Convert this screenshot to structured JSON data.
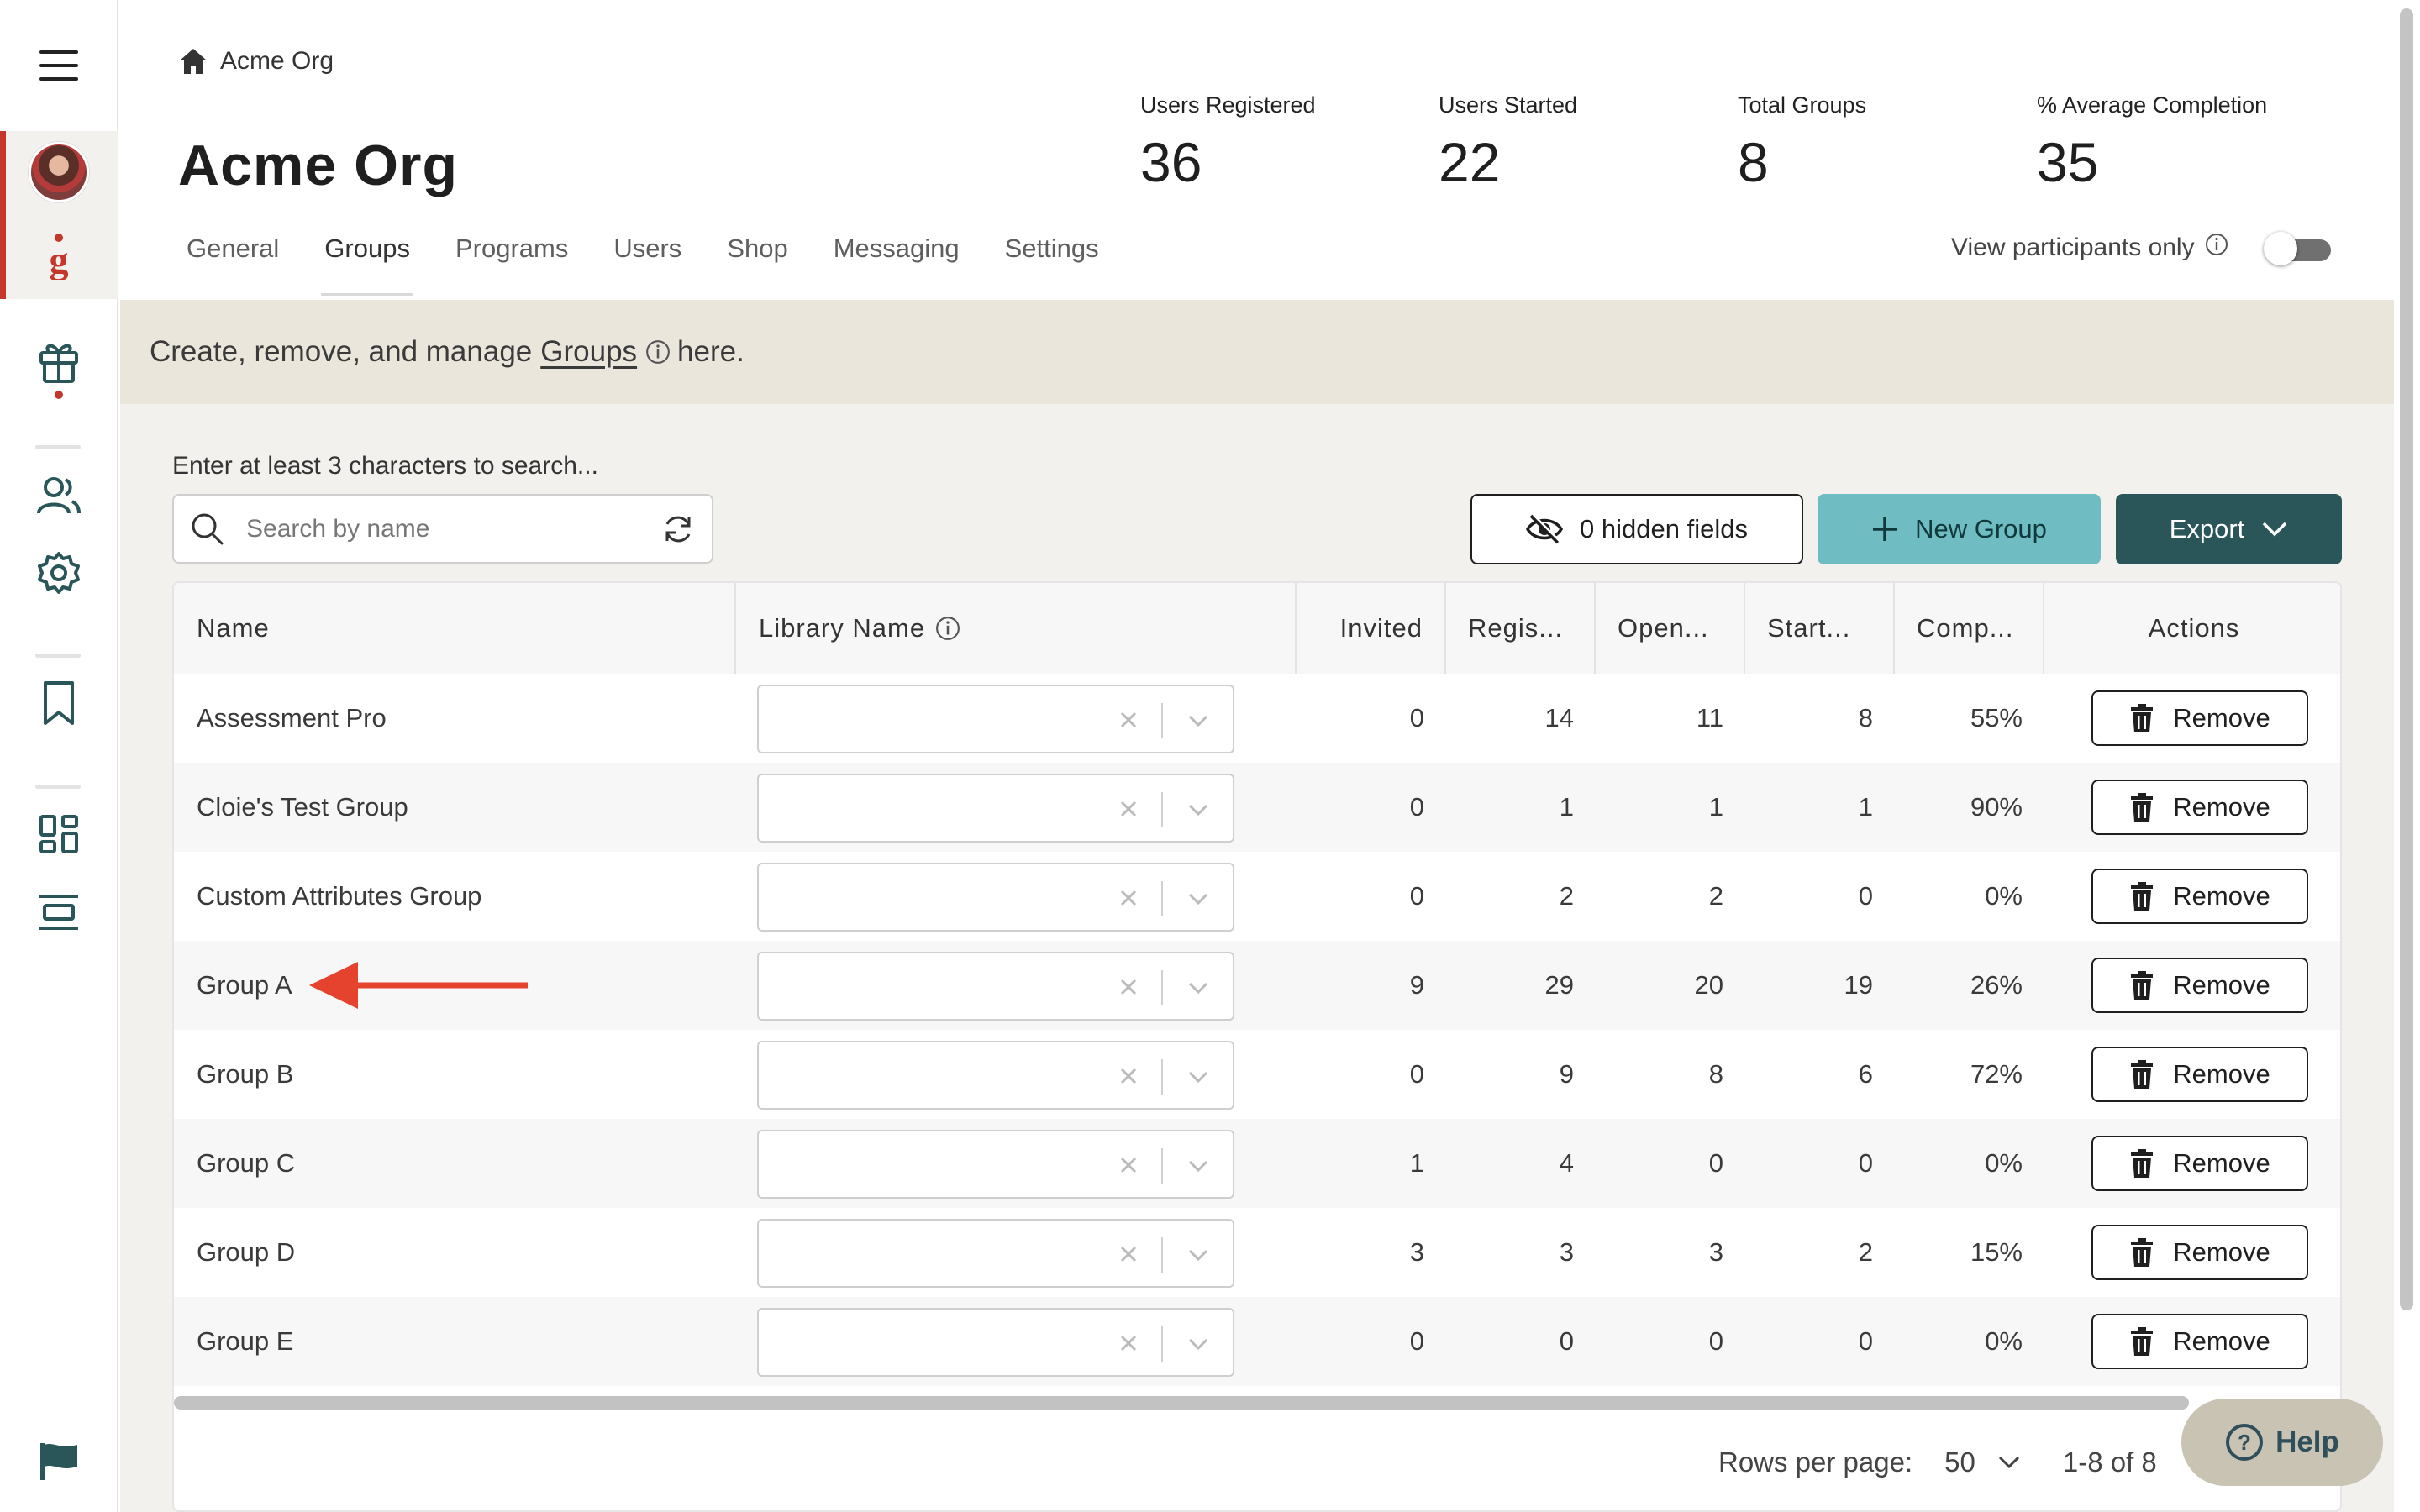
{
  "breadcrumb": {
    "label": "Acme Org"
  },
  "page": {
    "title": "Acme Org"
  },
  "stats": [
    {
      "label": "Users Registered",
      "value": "36"
    },
    {
      "label": "Users Started",
      "value": "22"
    },
    {
      "label": "Total Groups",
      "value": "8"
    },
    {
      "label": "% Average Completion",
      "value": "35"
    }
  ],
  "tabs": [
    "General",
    "Groups",
    "Programs",
    "Users",
    "Shop",
    "Messaging",
    "Settings"
  ],
  "active_tab": "Groups",
  "view_participants": {
    "label": "View participants only",
    "enabled": false
  },
  "banner": {
    "prefix": "Create, remove, and manage",
    "link": "Groups",
    "suffix": "here."
  },
  "search": {
    "hint": "Enter at least 3 characters to search...",
    "placeholder": "Search by name"
  },
  "toolbar": {
    "hidden_fields": "0 hidden fields",
    "new_group": "New Group",
    "export": "Export"
  },
  "table": {
    "headers": {
      "name": "Name",
      "library": "Library Name",
      "invited": "Invited",
      "registered": "Regis...",
      "opened": "Open...",
      "started": "Start...",
      "completion": "Comp...",
      "actions": "Actions"
    },
    "remove_label": "Remove",
    "rows": [
      {
        "name": "Assessment Pro",
        "invited": "0",
        "registered": "14",
        "opened": "11",
        "started": "8",
        "completion": "55%"
      },
      {
        "name": "Cloie's Test Group",
        "invited": "0",
        "registered": "1",
        "opened": "1",
        "started": "1",
        "completion": "90%"
      },
      {
        "name": "Custom Attributes Group",
        "invited": "0",
        "registered": "2",
        "opened": "2",
        "started": "0",
        "completion": "0%"
      },
      {
        "name": "Group A",
        "invited": "9",
        "registered": "29",
        "opened": "20",
        "started": "19",
        "completion": "26%"
      },
      {
        "name": "Group B",
        "invited": "0",
        "registered": "9",
        "opened": "8",
        "started": "6",
        "completion": "72%"
      },
      {
        "name": "Group C",
        "invited": "1",
        "registered": "4",
        "opened": "0",
        "started": "0",
        "completion": "0%"
      },
      {
        "name": "Group D",
        "invited": "3",
        "registered": "3",
        "opened": "3",
        "started": "2",
        "completion": "15%"
      },
      {
        "name": "Group E",
        "invited": "0",
        "registered": "0",
        "opened": "0",
        "started": "0",
        "completion": "0%"
      }
    ]
  },
  "footer": {
    "rows_per_page_label": "Rows per page:",
    "rows_per_page": "50",
    "range": "1-8 of 8"
  },
  "help": {
    "label": "Help"
  },
  "colors": {
    "accent_red": "#c5362b",
    "teal": "#6fbcc2",
    "dark_teal": "#2a5659",
    "banner_bg": "#ebe6dc",
    "annotation_arrow": "#e5432e"
  }
}
